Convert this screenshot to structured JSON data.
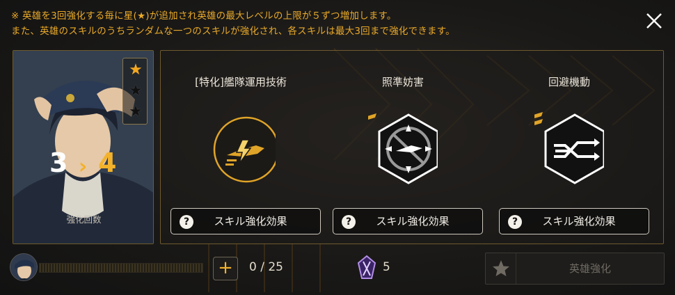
{
  "notice": {
    "line1": "※ 英雄を3回強化する毎に星(★)が追加され英雄の最大レベルの上限が５ずつ増加します。",
    "line2": "また、英雄のスキルのうちランダムな一つのスキルが強化され、各スキルは最大3回まで強化できます。"
  },
  "hero": {
    "stars": [
      "filled",
      "empty",
      "empty"
    ],
    "count_from": "3",
    "count_arrow": "›",
    "count_to": "4",
    "caption": "強化回数"
  },
  "skills": [
    {
      "name": "[特化]艦隊運用技術",
      "icon": "fleet-ops-icon",
      "level": 0,
      "effect_label": "スキル強化効果"
    },
    {
      "name": "照準妨害",
      "icon": "aim-jamming-icon",
      "level": 1,
      "effect_label": "スキル強化効果"
    },
    {
      "name": "回避機動",
      "icon": "evasive-maneuver-icon",
      "level": 2,
      "effect_label": "スキル強化効果"
    }
  ],
  "footer": {
    "progress_value": 0,
    "progress_max": 25,
    "progress_text": "0 / 25",
    "plus_label": "+",
    "gem_count": "5",
    "enhance_label": "英雄強化"
  },
  "colors": {
    "accent": "#f3b22b",
    "frame": "#6e5a2e",
    "disabled_text": "#6f6a62"
  }
}
